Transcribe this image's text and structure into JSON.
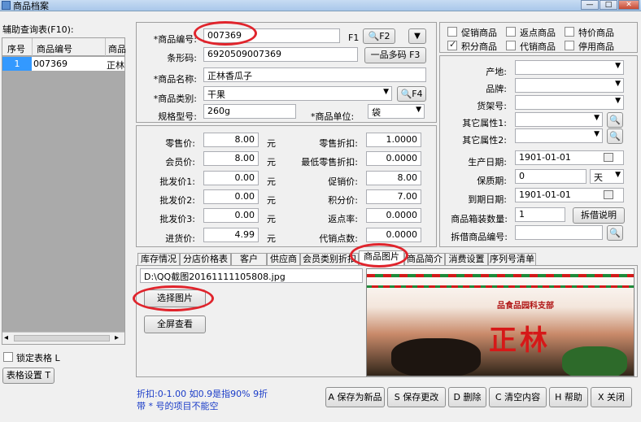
{
  "window": {
    "title": "商品档案",
    "minimize": "—",
    "maximize": "□",
    "close": "✕"
  },
  "aux_table": {
    "title": "辅助查询表(F10):",
    "headers": [
      "序号",
      "商品编号",
      "商品"
    ],
    "rows": [
      {
        "seq": "1",
        "code": "007369",
        "name": "正林"
      }
    ],
    "scroll_left": "◂",
    "scroll_right": "▸",
    "lock_label": "锁定表格 L",
    "settings_button": "表格设置 T"
  },
  "product": {
    "code_label": "*商品编号:",
    "code_value": "007369",
    "code_key": "F1",
    "f2_button": "F2",
    "collapse_icon": "▼",
    "barcode_label": "条形码:",
    "barcode_value": "6920509007369",
    "multi_barcode_button": "一品多码 F3",
    "name_label": "*商品名称:",
    "name_value": "正林香瓜子",
    "category_label": "*商品类别:",
    "category_value": "干果",
    "f4_button": "F4",
    "spec_label": "规格型号:",
    "spec_value": "260g",
    "unit_label": "*商品单位:",
    "unit_value": "袋"
  },
  "flags": [
    {
      "label": "促销商品",
      "checked": false
    },
    {
      "label": "返点商品",
      "checked": false
    },
    {
      "label": "特价商品",
      "checked": false
    },
    {
      "label": "积分商品",
      "checked": true
    },
    {
      "label": "代销商品",
      "checked": false
    },
    {
      "label": "停用商品",
      "checked": false
    }
  ],
  "attributes": {
    "origin_label": "产地:",
    "brand_label": "品牌:",
    "shelf_label": "货架号:",
    "attr1_label": "其它属性1:",
    "attr2_label": "其它属性2:",
    "prod_date_label": "生产日期:",
    "prod_date_value": "1901-01-01",
    "shelf_life_label": "保质期:",
    "shelf_life_value": "0",
    "shelf_life_unit": "天",
    "expire_label": "到期日期:",
    "expire_value": "1901-01-01",
    "box_qty_label": "商品箱装数量:",
    "box_qty_value": "1",
    "split_button": "拆借说明",
    "split_code_label": "拆借商品编号:"
  },
  "prices": {
    "retail_label": "零售价:",
    "retail_value": "8.00",
    "member_label": "会员价:",
    "member_value": "8.00",
    "wholesale1_label": "批发价1:",
    "wholesale1_value": "0.00",
    "wholesale2_label": "批发价2:",
    "wholesale2_value": "0.00",
    "wholesale3_label": "批发价3:",
    "wholesale3_value": "0.00",
    "purchase_label": "进货价:",
    "purchase_value": "4.99",
    "currency": "元",
    "retail_discount_label": "零售折扣:",
    "retail_discount_value": "1.0000",
    "min_discount_label": "最低零售折扣:",
    "min_discount_value": "0.0000",
    "promo_price_label": "促销价:",
    "promo_price_value": "8.00",
    "points_price_label": "积分价:",
    "points_price_value": "7.00",
    "rebate_rate_label": "返点率:",
    "rebate_rate_value": "0.0000",
    "consign_points_label": "代销点数:",
    "consign_points_value": "0.0000"
  },
  "tabs": [
    "库存情况",
    "分店价格表",
    "客户",
    "供应商",
    "会员类别折扣",
    "商品图片",
    "商品简介",
    "消费设置",
    "序列号清单"
  ],
  "image_tab": {
    "path": "D:\\QQ截图20161111105808.jpg",
    "choose_button": "选择图片",
    "fullscreen_button": "全屏查看",
    "image_text_brand": "正林",
    "image_text_banner": "品食品园科支部"
  },
  "footer": {
    "hint1": "折扣:0-1.00 如0.9是指90%  9折",
    "hint2": "带 * 号的项目不能空",
    "buttons": [
      "A 保存为新品",
      "S 保存更改",
      "D 删除",
      "C 清空内容",
      "H 帮助",
      "X 关闭"
    ]
  },
  "colors": {
    "accent_red": "#e0242c",
    "hint_blue": "#1a3cc8",
    "selection": "#3399ff"
  }
}
